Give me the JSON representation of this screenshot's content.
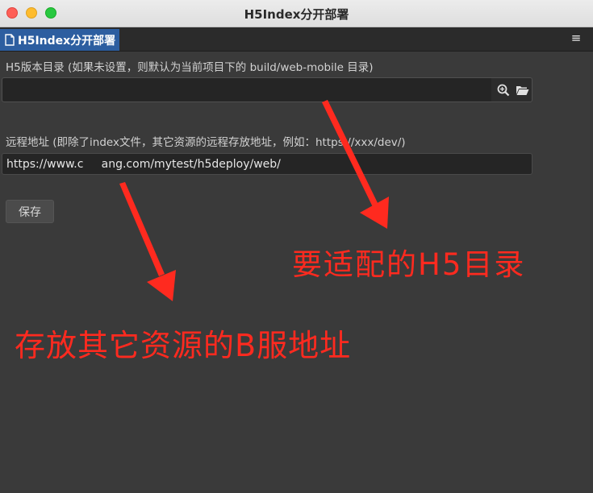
{
  "window": {
    "title": "H5Index分开部署"
  },
  "tab": {
    "label": "H5Index分开部署",
    "icon": "document-icon"
  },
  "menu": {
    "icon": "hamburger-menu-icon",
    "glyph": "≡"
  },
  "form": {
    "dir_label": "H5版本目录 (如果未设置，则默认为当前项目下的 build/web-mobile 目录)",
    "dir_value": "",
    "dir_search_icon": "search-icon",
    "dir_folder_icon": "folder-open-icon",
    "remote_label": "远程地址 (即除了index文件，其它资源的远程存放地址，例如：https://xxx/dev/)",
    "remote_value": "https://www.c     ang.com/mytest/h5deploy/web/",
    "save_label": "保存"
  },
  "annotations": {
    "h5_dir_note": "要适配的H5目录",
    "remote_note": "存放其它资源的B服地址",
    "color": "#ff2a1f"
  }
}
